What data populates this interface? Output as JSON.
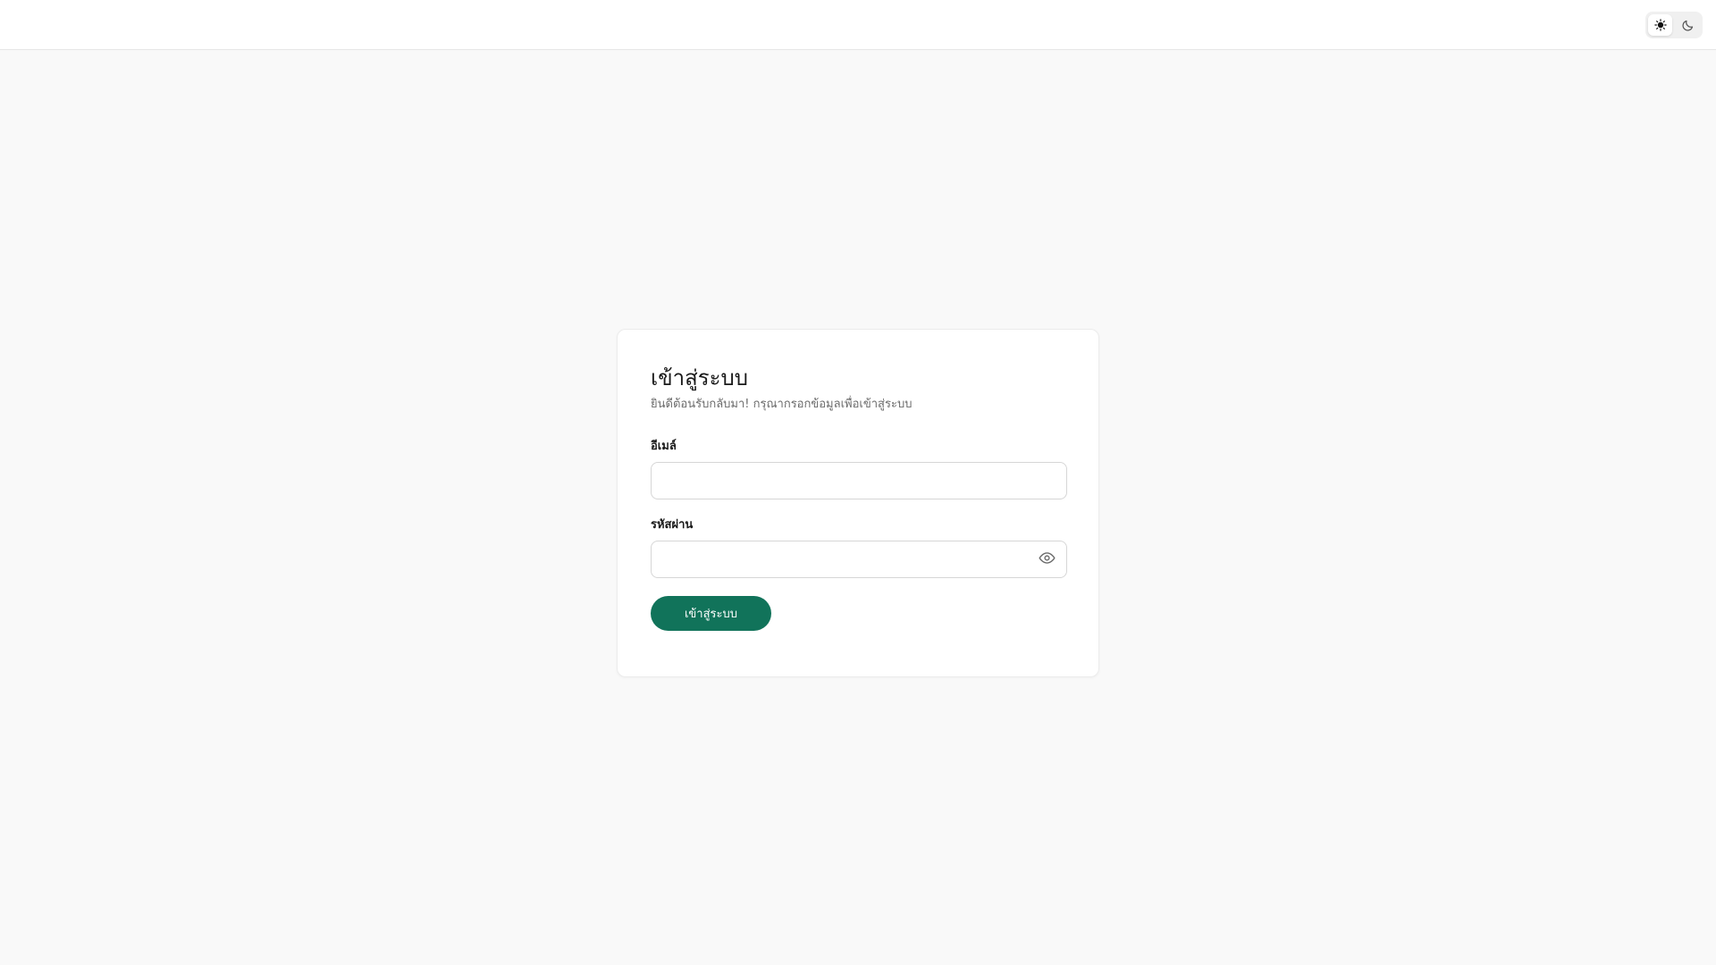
{
  "header": {
    "theme_toggle": {
      "light_icon": "sun-icon",
      "dark_icon": "moon-icon",
      "selected": "light"
    }
  },
  "login": {
    "title": "เข้าสู่ระบบ",
    "subtitle": "ยินดีต้อนรับกลับมา! กรุณากรอกข้อมูลเพื่อเข้าสู่ระบบ",
    "email": {
      "label": "อีเมล์",
      "value": "",
      "placeholder": ""
    },
    "password": {
      "label": "รหัสผ่าน",
      "value": "",
      "placeholder": "",
      "toggle_icon": "eye-icon"
    },
    "submit_label": "เข้าสู่ระบบ"
  },
  "colors": {
    "accent": "#11735a",
    "page_background": "#f9f9f9",
    "card_background": "#ffffff"
  }
}
